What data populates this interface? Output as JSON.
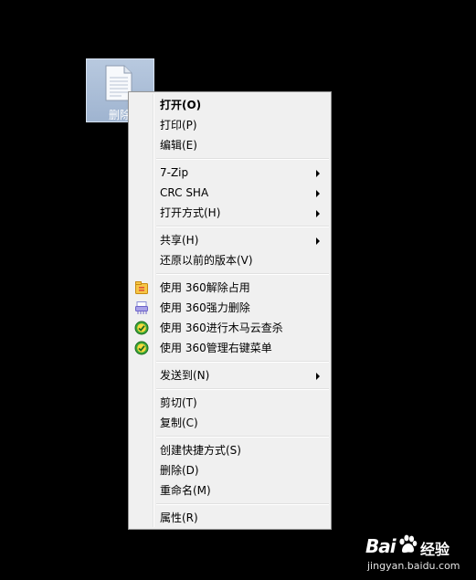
{
  "desktop_file": {
    "label": "删除",
    "icon": "text-document-icon"
  },
  "context_menu": {
    "groups": [
      [
        {
          "label": "打开(O)",
          "bold": true
        },
        {
          "label": "打印(P)"
        },
        {
          "label": "编辑(E)"
        }
      ],
      [
        {
          "label": "7-Zip",
          "submenu": true
        },
        {
          "label": "CRC SHA",
          "submenu": true
        },
        {
          "label": "打开方式(H)",
          "submenu": true
        }
      ],
      [
        {
          "label": "共享(H)",
          "submenu": true
        },
        {
          "label": "还原以前的版本(V)"
        }
      ],
      [
        {
          "label": "使用 360解除占用",
          "icon": "360-unlock-icon"
        },
        {
          "label": "使用 360强力删除",
          "icon": "360-shredder-icon"
        },
        {
          "label": "使用 360进行木马云查杀",
          "icon": "360-shield-icon"
        },
        {
          "label": "使用 360管理右键菜单",
          "icon": "360-shield-icon"
        }
      ],
      [
        {
          "label": "发送到(N)",
          "submenu": true
        }
      ],
      [
        {
          "label": "剪切(T)"
        },
        {
          "label": "复制(C)"
        }
      ],
      [
        {
          "label": "创建快捷方式(S)"
        },
        {
          "label": "删除(D)"
        },
        {
          "label": "重命名(M)"
        }
      ],
      [
        {
          "label": "属性(R)"
        }
      ]
    ]
  },
  "watermark": {
    "logo_left": "Bai",
    "logo_right": "经验",
    "url": "jingyan.baidu.com"
  },
  "colors": {
    "background": "#000000",
    "menu_bg": "#f0f0f0",
    "selection": "#b8c9df"
  }
}
